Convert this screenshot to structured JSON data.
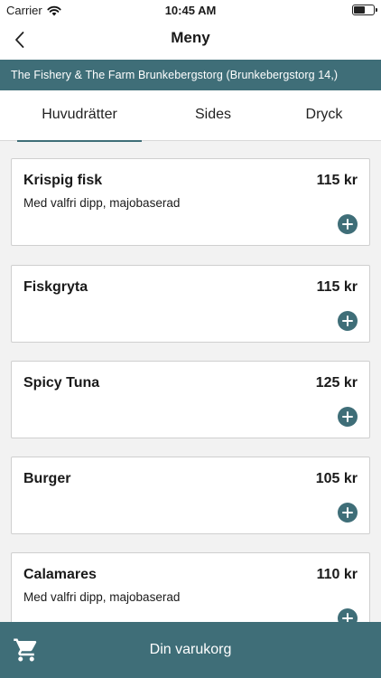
{
  "status": {
    "carrier": "Carrier",
    "time": "10:45 AM",
    "icons": [
      "wifi-icon",
      "battery-icon"
    ]
  },
  "navbar": {
    "back_icon": "chevron-left-icon",
    "title": "Meny"
  },
  "location": "The Fishery & The Farm Brunkebergstorg (Brunkebergstorg 14,)",
  "tabs": [
    {
      "label": "Huvudrätter",
      "active": true
    },
    {
      "label": "Sides",
      "active": false
    },
    {
      "label": "Dryck",
      "active": false
    }
  ],
  "menu_items": [
    {
      "name": "Krispig fisk",
      "price": "115 kr",
      "description": "Med valfri dipp, majobaserad"
    },
    {
      "name": "Fiskgryta",
      "price": "115 kr",
      "description": ""
    },
    {
      "name": "Spicy Tuna",
      "price": "125 kr",
      "description": ""
    },
    {
      "name": "Burger",
      "price": "105 kr",
      "description": ""
    },
    {
      "name": "Calamares",
      "price": "110 kr",
      "description": "Med valfri dipp, majobaserad"
    }
  ],
  "cart": {
    "icon": "shopping-cart-icon",
    "label": "Din varukorg"
  },
  "colors": {
    "accent": "#3f6e78",
    "background": "#f2f2f2"
  }
}
